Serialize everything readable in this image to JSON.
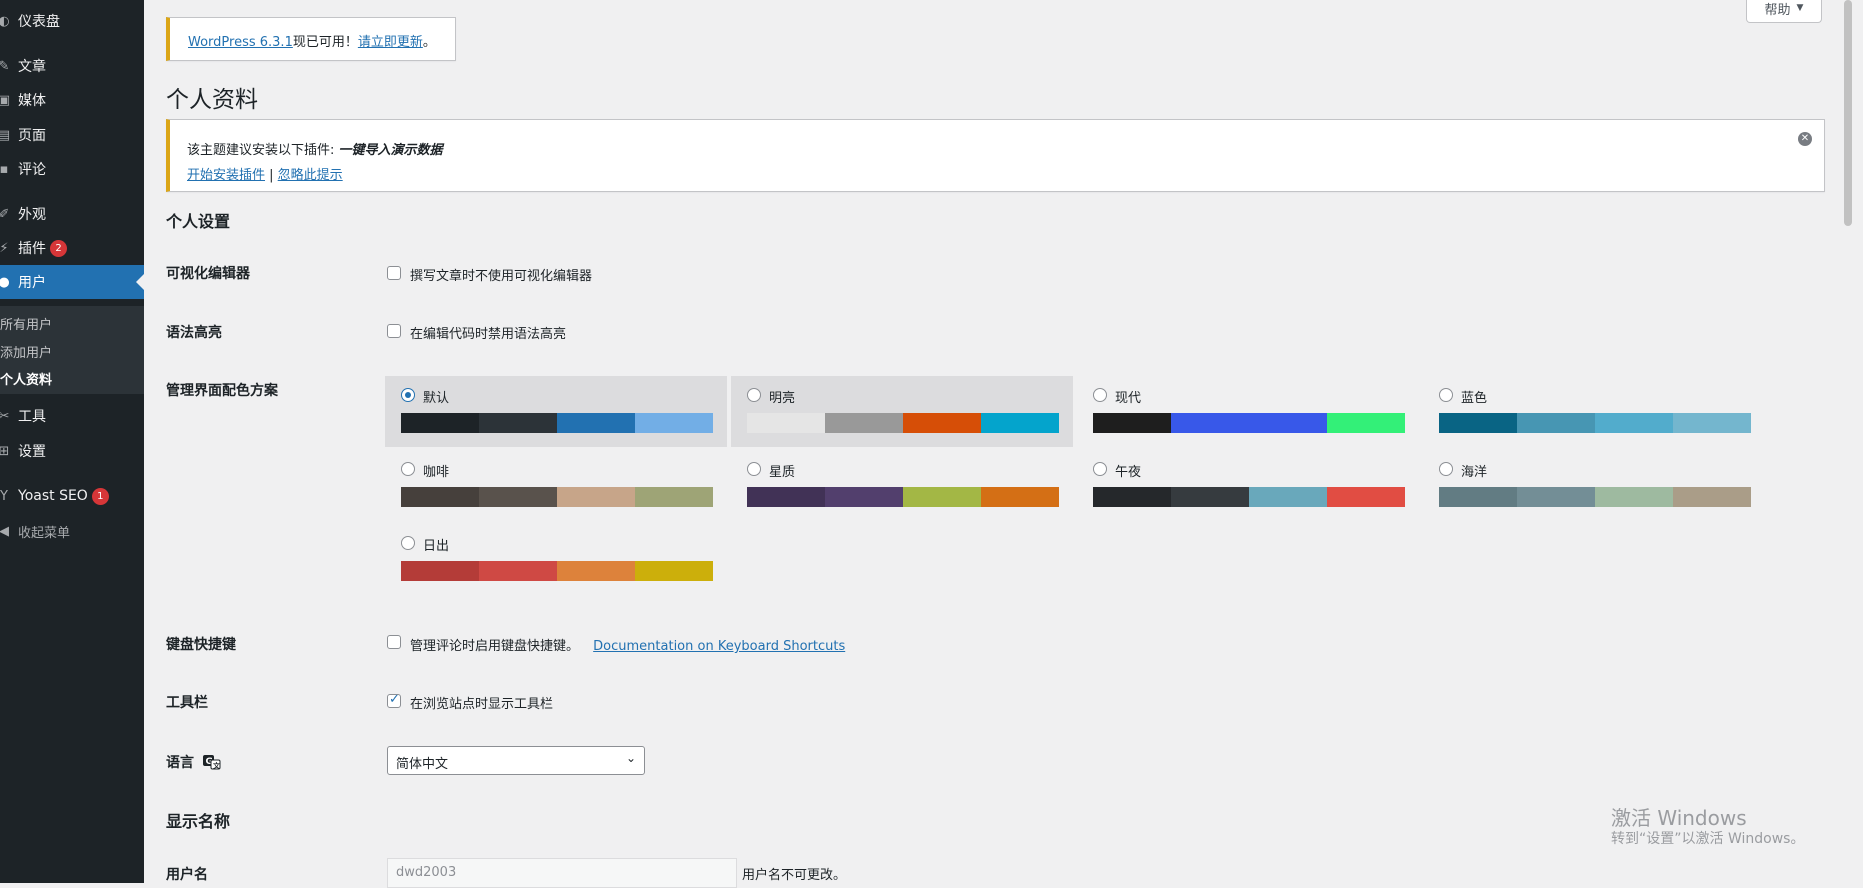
{
  "sidebar": {
    "items": [
      {
        "icon": "dashboard-icon",
        "glyph": "◐",
        "label": "仪表盘"
      },
      {
        "icon": "pin-icon",
        "glyph": "✎",
        "label": "文章"
      },
      {
        "icon": "media-icon",
        "glyph": "▣",
        "label": "媒体"
      },
      {
        "icon": "page-icon",
        "glyph": "▤",
        "label": "页面"
      },
      {
        "icon": "comment-icon",
        "glyph": "▪",
        "label": "评论"
      },
      {
        "icon": "appearance-icon",
        "glyph": "✐",
        "label": "外观"
      },
      {
        "icon": "plugin-icon",
        "glyph": "⚡",
        "label": "插件",
        "badge": "2"
      },
      {
        "icon": "users-icon",
        "glyph": "●",
        "label": "用户"
      },
      {
        "icon": "tools-icon",
        "glyph": "✂",
        "label": "工具"
      },
      {
        "icon": "settings-icon",
        "glyph": "⊞",
        "label": "设置"
      },
      {
        "icon": "yoast-icon",
        "glyph": "Y",
        "label": "Yoast SEO",
        "badge": "1"
      },
      {
        "icon": "collapse-icon",
        "glyph": "◀",
        "label": "收起菜单"
      }
    ],
    "submenu": [
      "所有用户",
      "添加用户",
      "个人资料"
    ]
  },
  "help_tab": {
    "label": "帮助",
    "arrow": "▼"
  },
  "update_notice": {
    "link1": "WordPress 6.3.1",
    "text1": "现已可用！",
    "link2": "请立即更新",
    "text2": "。"
  },
  "page_title": "个人资料",
  "plugin_notice": {
    "prefix": "该主题建议安装以下插件: ",
    "plugin_name": "一键导入演示数据",
    "install_link": "开始安装插件",
    "separator": " | ",
    "dismiss_link": "忽略此提示",
    "dismiss_icon": "✕"
  },
  "personal_settings": {
    "heading": "个人设置",
    "visual_editor": {
      "label": "可视化编辑器",
      "option": "撰写文章时不使用可视化编辑器",
      "checked": false
    },
    "syntax": {
      "label": "语法高亮",
      "option": "在编辑代码时禁用语法高亮",
      "checked": false
    },
    "color_scheme": {
      "label": "管理界面配色方案",
      "schemes": [
        {
          "name": "默认",
          "colors": [
            "#1d2327",
            "#2c3338",
            "#2271b1",
            "#72aee6"
          ],
          "selected": true
        },
        {
          "name": "明亮",
          "colors": [
            "#e5e5e5",
            "#999999",
            "#d64e07",
            "#04a4cc"
          ],
          "selected": false
        },
        {
          "name": "现代",
          "colors": [
            "#1e1e1e",
            "#3858e9",
            "#3858e9",
            "#33f078"
          ],
          "selected": false
        },
        {
          "name": "蓝色",
          "colors": [
            "#096484",
            "#4796b3",
            "#52accc",
            "#74b6ce"
          ],
          "selected": false
        },
        {
          "name": "咖啡",
          "colors": [
            "#46403c",
            "#59524c",
            "#c7a589",
            "#9ea476"
          ],
          "selected": false
        },
        {
          "name": "星质",
          "colors": [
            "#413256",
            "#523f6d",
            "#a3b745",
            "#d46f15"
          ],
          "selected": false
        },
        {
          "name": "午夜",
          "colors": [
            "#25282b",
            "#363b3f",
            "#69a8bb",
            "#e14d43"
          ],
          "selected": false
        },
        {
          "name": "海洋",
          "colors": [
            "#627c83",
            "#738e96",
            "#9ebaa0",
            "#aa9d88"
          ],
          "selected": false
        },
        {
          "name": "日出",
          "colors": [
            "#b43c38",
            "#cf4944",
            "#dd823b",
            "#ccaf0b"
          ],
          "selected": false
        }
      ]
    },
    "keyboard": {
      "label": "键盘快捷键",
      "option": "管理评论时启用键盘快捷键。",
      "link": "Documentation on Keyboard Shortcuts",
      "checked": false
    },
    "toolbar": {
      "label": "工具栏",
      "option": "在浏览站点时显示工具栏",
      "checked": true
    },
    "language": {
      "label": "语言",
      "icon": "translate-icon",
      "value": "简体中文",
      "chevron": "⌄"
    }
  },
  "display_name": {
    "heading": "显示名称",
    "username_label": "用户名",
    "username_value": "dwd2003",
    "username_note": "用户名不可更改。"
  },
  "watermark": {
    "line1": "激活 Windows",
    "line2": "转到“设置”以激活 Windows。"
  }
}
